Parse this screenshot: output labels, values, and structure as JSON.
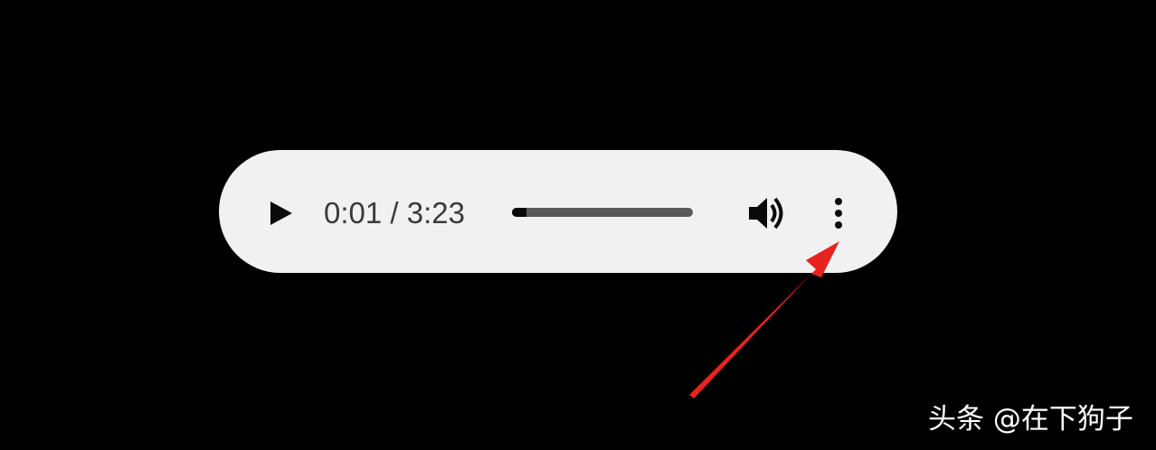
{
  "player": {
    "current_time": "0:01",
    "duration": "3:23",
    "time_display": "0:01 / 3:23",
    "progress_fraction": 0.005,
    "controls": {
      "play_icon": "play-icon",
      "volume_icon": "volume-icon",
      "more_icon": "more-vertical-icon"
    }
  },
  "annotation": {
    "arrow_color": "#e8231f",
    "arrow_icon": "red-arrow-icon"
  },
  "watermark": {
    "text": "头条 @在下狗子"
  },
  "colors": {
    "background": "#000000",
    "player_bg": "#f1f1f2",
    "control": "#0a0a0a",
    "text": "#3a3a3a",
    "track": "#595959"
  }
}
